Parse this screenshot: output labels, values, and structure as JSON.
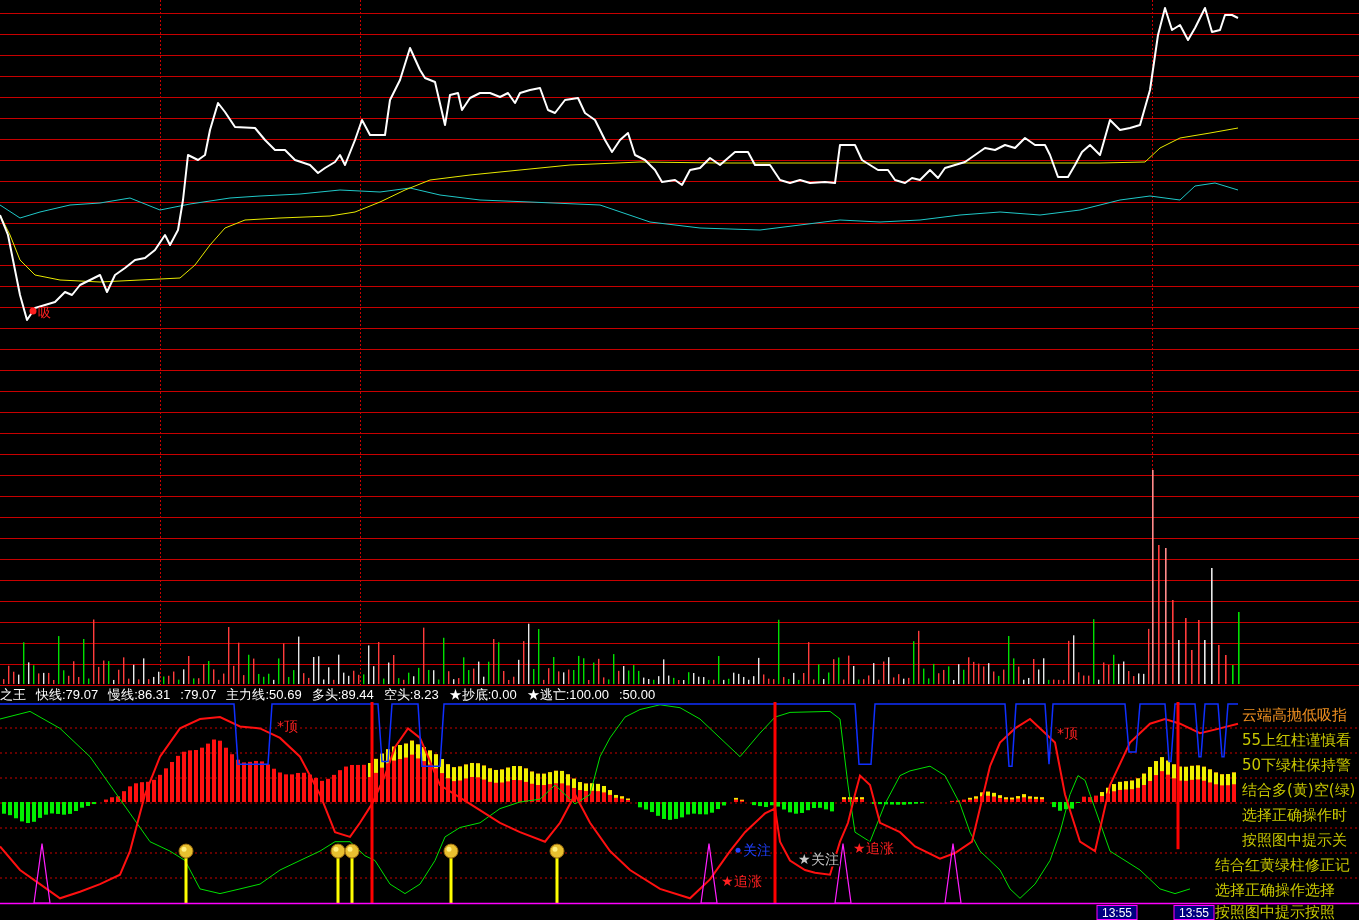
{
  "price_chart": {
    "signal_label": "吸"
  },
  "legend": [
    "之王",
    "快线:79.07",
    "慢线:86.31",
    ":79.07",
    "主力线:50.69",
    "多头:89.44",
    "空头:8.23",
    "★抄底:0.00",
    "★逃亡:100.00",
    ":50.00"
  ],
  "indicator_chart": {
    "labels": [
      {
        "kind": "top",
        "text": "*顶"
      },
      {
        "kind": "chase",
        "text": "★追涨"
      },
      {
        "kind": "watch",
        "text": "关注"
      },
      {
        "kind": "watch_star",
        "text": "★关注"
      },
      {
        "kind": "chase",
        "text": "★追涨"
      },
      {
        "kind": "top",
        "text": "*顶"
      }
    ],
    "time_axis": [
      {
        "kind": "cursor",
        "text": "13:55"
      },
      {
        "kind": "cursor",
        "text": "13:55"
      }
    ]
  },
  "notes_panel": {
    "title": "云端高抛低吸指",
    "lines": [
      "55上红柱谨慎看",
      "50下绿柱保持警",
      "结合多(黄)空(绿)",
      "选择正确操作时",
      "按照图中提示关",
      "结合红黄绿柱修正记",
      "选择正确操作选择",
      "按照图中提示按照"
    ]
  }
}
